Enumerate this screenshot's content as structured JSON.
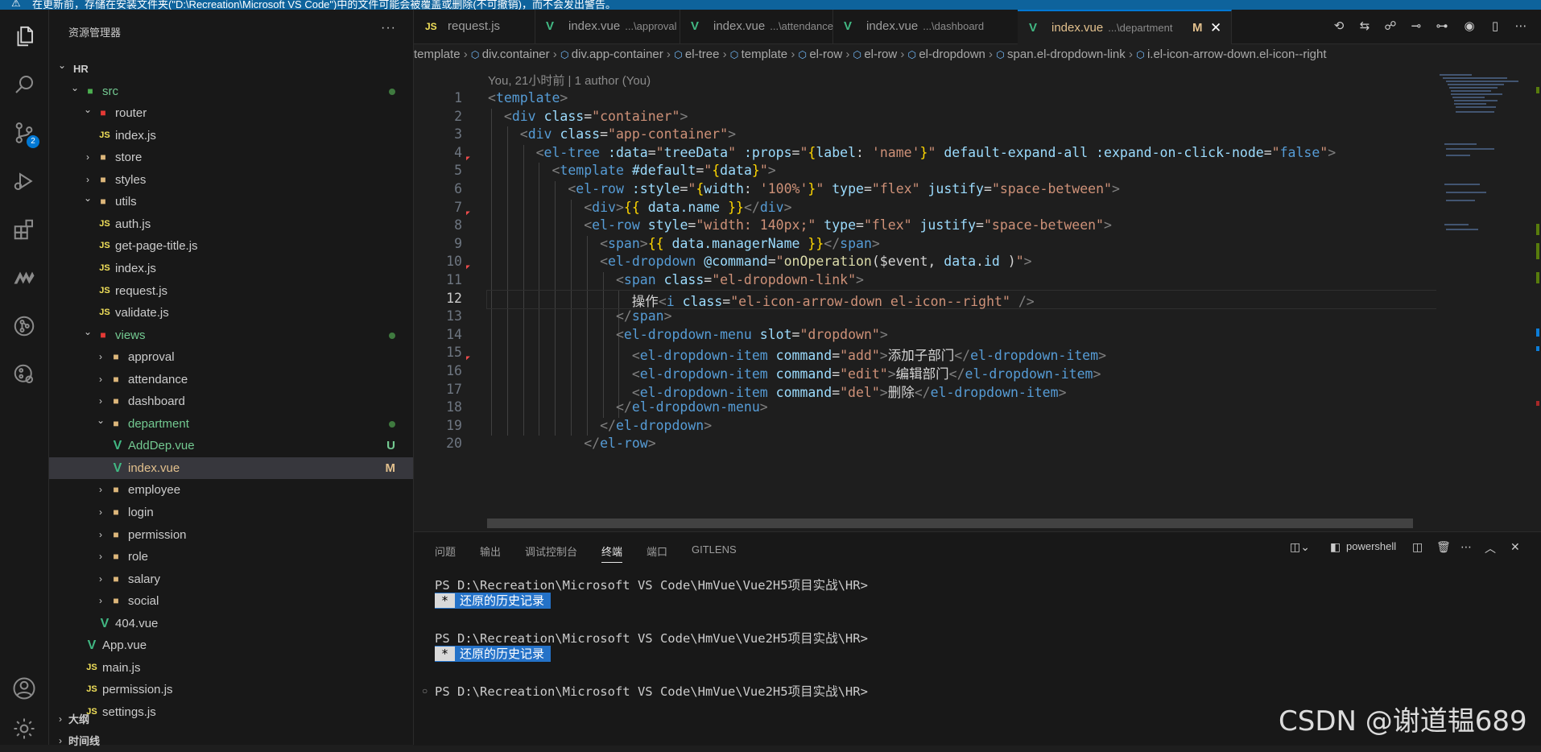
{
  "notification": {
    "text": "在更新前，存储在安装文件夹(\"D:\\Recreation\\Microsoft VS Code\")中的文件可能会被覆盖或删除(不可撤销)，而不会发出警告。"
  },
  "activity": {
    "scm_badge": "2"
  },
  "sidebar": {
    "title": "资源管理器",
    "more": "···",
    "tree": [
      {
        "label": "HR",
        "icon": "",
        "chev": "⌄",
        "status": "",
        "indent": 0
      },
      {
        "label": "src",
        "icon": "src-folder",
        "chev": "⌄",
        "status": "dot",
        "indent": 1
      },
      {
        "label": "router",
        "icon": "router-folder",
        "chev": "⌄",
        "status": "",
        "indent": 2
      },
      {
        "label": "index.js",
        "icon": "JS",
        "chev": "",
        "status": "",
        "indent": 3
      },
      {
        "label": "store",
        "icon": "folder",
        "chev": "›",
        "status": "",
        "indent": 2
      },
      {
        "label": "styles",
        "icon": "folder",
        "chev": "›",
        "status": "",
        "indent": 2
      },
      {
        "label": "utils",
        "icon": "utils-folder",
        "chev": "⌄",
        "status": "",
        "indent": 2
      },
      {
        "label": "auth.js",
        "icon": "JS",
        "chev": "",
        "status": "",
        "indent": 3
      },
      {
        "label": "get-page-title.js",
        "icon": "JS",
        "chev": "",
        "status": "",
        "indent": 3
      },
      {
        "label": "index.js",
        "icon": "JS",
        "chev": "",
        "status": "",
        "indent": 3
      },
      {
        "label": "request.js",
        "icon": "JS",
        "chev": "",
        "status": "",
        "indent": 3
      },
      {
        "label": "validate.js",
        "icon": "JS",
        "chev": "",
        "status": "",
        "indent": 3
      },
      {
        "label": "views",
        "icon": "views-folder",
        "chev": "⌄",
        "status": "dot",
        "indent": 2
      },
      {
        "label": "approval",
        "icon": "folder",
        "chev": "›",
        "status": "",
        "indent": 3
      },
      {
        "label": "attendance",
        "icon": "folder",
        "chev": "›",
        "status": "",
        "indent": 3
      },
      {
        "label": "dashboard",
        "icon": "folder",
        "chev": "›",
        "status": "",
        "indent": 3
      },
      {
        "label": "department",
        "icon": "folder",
        "chev": "⌄",
        "status": "dot",
        "indent": 3
      },
      {
        "label": "AddDep.vue",
        "icon": "V",
        "chev": "",
        "status": "U",
        "indent": 4
      },
      {
        "label": "index.vue",
        "icon": "V",
        "chev": "",
        "status": "M",
        "indent": 4
      },
      {
        "label": "employee",
        "icon": "folder",
        "chev": "›",
        "status": "",
        "indent": 3
      },
      {
        "label": "login",
        "icon": "folder",
        "chev": "›",
        "status": "",
        "indent": 3
      },
      {
        "label": "permission",
        "icon": "folder",
        "chev": "›",
        "status": "",
        "indent": 3
      },
      {
        "label": "role",
        "icon": "folder",
        "chev": "›",
        "status": "",
        "indent": 3
      },
      {
        "label": "salary",
        "icon": "folder",
        "chev": "›",
        "status": "",
        "indent": 3
      },
      {
        "label": "social",
        "icon": "folder",
        "chev": "›",
        "status": "",
        "indent": 3
      },
      {
        "label": "404.vue",
        "icon": "V",
        "chev": "",
        "status": "",
        "indent": 3
      },
      {
        "label": "App.vue",
        "icon": "V",
        "chev": "",
        "status": "",
        "indent": 2
      },
      {
        "label": "main.js",
        "icon": "JS",
        "chev": "",
        "status": "",
        "indent": 2
      },
      {
        "label": "permission.js",
        "icon": "JS",
        "chev": "",
        "status": "",
        "indent": 2
      },
      {
        "label": "settings.js",
        "icon": "JS",
        "chev": "",
        "status": "",
        "indent": 2
      }
    ],
    "outline": "大纲",
    "timeline": "时间线"
  },
  "tabs": [
    {
      "icon": "JS",
      "label": "request.js",
      "path": "",
      "active": false,
      "mod": ""
    },
    {
      "icon": "V",
      "label": "index.vue",
      "path": "...\\approval",
      "active": false,
      "mod": ""
    },
    {
      "icon": "V",
      "label": "index.vue",
      "path": "...\\attendance",
      "active": false,
      "mod": ""
    },
    {
      "icon": "V",
      "label": "index.vue",
      "path": "...\\dashboard",
      "active": false,
      "mod": ""
    },
    {
      "icon": "V",
      "label": "index.vue",
      "path": "...\\department",
      "active": true,
      "mod": "M"
    }
  ],
  "breadcrumb": [
    "template",
    "div.container",
    "div.app-container",
    "el-tree",
    "template",
    "el-row",
    "el-row",
    "el-dropdown",
    "span.el-dropdown-link",
    "i.el-icon-arrow-down.el-icon--right"
  ],
  "blame": "You, 21小时前 | 1 author (You)",
  "code": {
    "current_line": 12,
    "lines": [
      "<template>",
      "  <div class=\"container\">",
      "    <div class=\"app-container\">",
      "      <el-tree :data=\"treeData\" :props=\"{label: 'name'}\" default-expand-all :expand-on-click-node=\"false\">",
      "        <template #default=\"{data}\">",
      "          <el-row :style=\"{width: '100%'}\" type=\"flex\" justify=\"space-between\">",
      "            <div>{{ data.name }}</div>",
      "            <el-row style=\"width: 140px;\" type=\"flex\" justify=\"space-between\">",
      "              <span>{{ data.managerName }}</span>",
      "              <el-dropdown @command=\"onOperation($event, data.id )\">",
      "                <span class=\"el-dropdown-link\">",
      "                  操作<i class=\"el-icon-arrow-down el-icon--right\" />",
      "                </span>",
      "                <el-dropdown-menu slot=\"dropdown\">",
      "                  <el-dropdown-item command=\"add\">添加子部门</el-dropdown-item>",
      "                  <el-dropdown-item command=\"edit\">编辑部门</el-dropdown-item>",
      "                  <el-dropdown-item command=\"del\">删除</el-dropdown-item>",
      "                </el-dropdown-menu>",
      "              </el-dropdown>",
      "            </el-row>"
    ]
  },
  "panel": {
    "tabs": [
      "问题",
      "输出",
      "调试控制台",
      "终端",
      "端口",
      "GITLENS"
    ],
    "active_tab": "终端",
    "shell": "powershell",
    "prompt": "PS D:\\Recreation\\Microsoft VS Code\\HmVue\\Vue2H5项目实战\\HR>",
    "history": "还原的历史记录",
    "history_star": "*"
  },
  "watermark": "CSDN @谢道韫689"
}
